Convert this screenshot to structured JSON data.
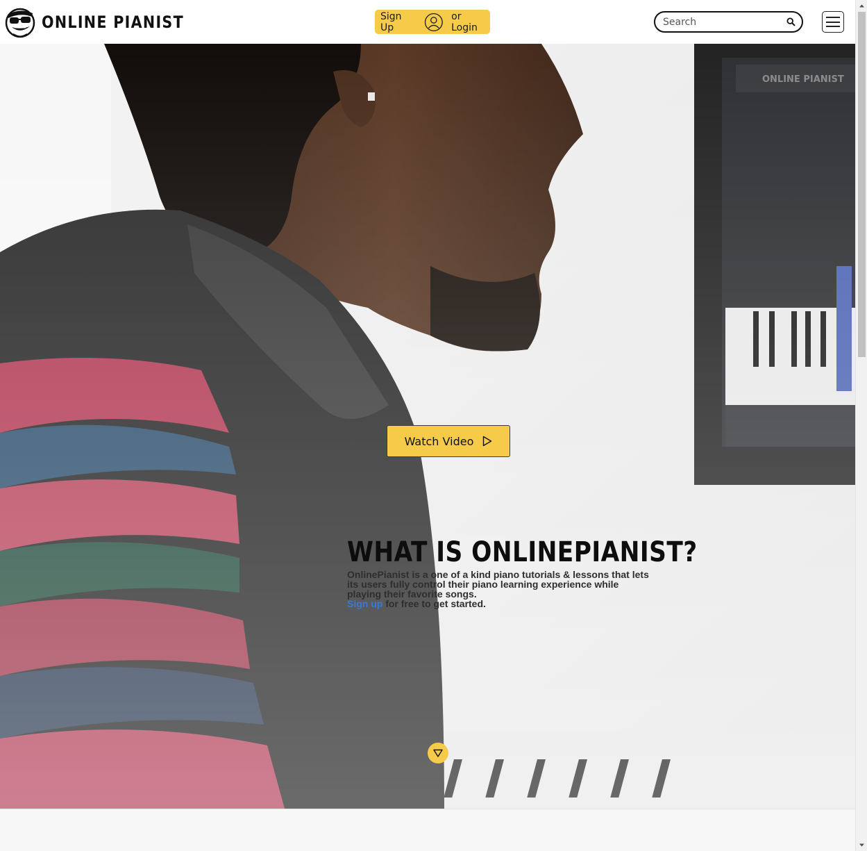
{
  "header": {
    "logo_text": "ONLINE PIANIST",
    "logo_icon": "sunglasses-mascot-icon",
    "auth": {
      "signup_label": "Sign Up",
      "user_icon": "user-circle-icon",
      "login_label": "or Login"
    },
    "search": {
      "placeholder": "Search",
      "value": "",
      "icon": "search-icon"
    },
    "menu_icon": "hamburger-icon"
  },
  "hero": {
    "background_image": "person-playing-piano-photo",
    "watch_video": {
      "label": "Watch Video",
      "icon": "play-outline-icon"
    },
    "about": {
      "title": "WHAT IS ONLINEPIANIST?",
      "description": "OnlinePianist is a one of a kind piano tutorials & lessons that lets its users fully control their piano learning experience while playing their favorite songs.",
      "cta_link": "Sign up",
      "cta_rest": " for free to get started."
    },
    "scroll_icon": "triangle-down-icon"
  },
  "colors": {
    "accent": "#f5cb49",
    "link": "#3b78d8",
    "text_dark": "#111111"
  }
}
